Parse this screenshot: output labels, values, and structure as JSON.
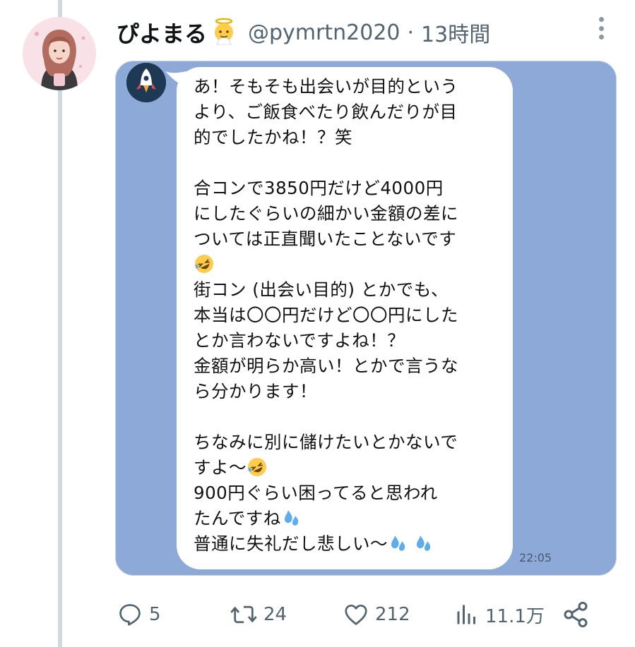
{
  "tweet": {
    "display_name": "ぴよまる",
    "handle": "@pymrtn2020",
    "separator": "·",
    "time": "13時間"
  },
  "message": {
    "lines": [
      "あ！そもそも出会いが目的という",
      "より、ご飯食べたり飲んだりが目",
      "的でしたかね！？笑",
      "",
      "合コンで3850円だけど4000円",
      "にしたぐらいの細かい金額の差に",
      "ついては正直聞いたことないです",
      "",
      "街コン (出会い目的) とかでも、",
      "本当は〇〇円だけど〇〇円にした",
      "とか言わないですよね！？",
      "金額が明らか高い！とかで言うな",
      "ら分かります！",
      "",
      "ちなみに別に儲けたいとかないで",
      "すよ〜",
      "900円ぐらい困ってると思われ",
      "たんですね",
      "普通に失礼だし悲しい〜"
    ],
    "timestamp": "22:05"
  },
  "actions": {
    "replies": "5",
    "retweets": "24",
    "likes": "212",
    "views": "11.1万"
  },
  "icons": {
    "reply": "reply-icon",
    "retweet": "retweet-icon",
    "like": "heart-icon",
    "views": "views-icon",
    "share": "share-icon",
    "more": "more-icon"
  },
  "colors": {
    "chat_background": "#8da9d8",
    "bubble": "#ffffff",
    "secondary_text": "#536471",
    "thread_line": "#cfd9de"
  }
}
